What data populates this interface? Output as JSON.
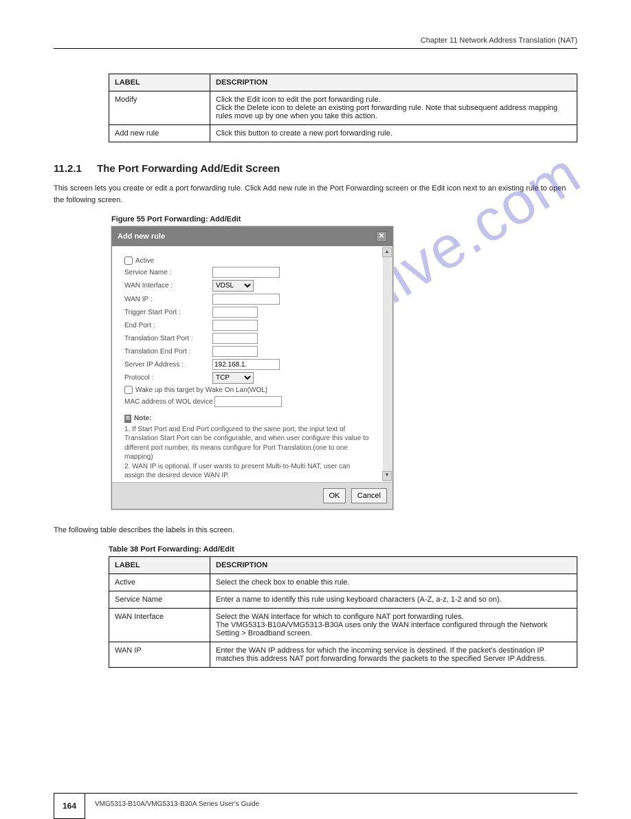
{
  "header": {
    "chapter": "Chapter 11 Network Address Translation (NAT)"
  },
  "watermark": "manualshive.com",
  "table1": {
    "headers": [
      "LABEL",
      "DESCRIPTION"
    ],
    "rows": [
      [
        "Modify",
        "Click the Edit icon to edit the port forwarding rule.\nClick the Delete icon to delete an existing port forwarding rule. Note that subsequent address mapping rules move up by one when you take this action."
      ],
      [
        "Add new rule",
        "Click this button to create a new port forwarding rule."
      ]
    ]
  },
  "section": {
    "number": "11.2.1",
    "title": "The Port Forwarding Add/Edit Screen",
    "intro": "This screen lets you create or edit a port forwarding rule. Click Add new rule in the Port Forwarding screen or the Edit icon next to an existing rule to open the following screen."
  },
  "figure": {
    "caption": "Figure 55   Port Forwarding: Add/Edit"
  },
  "dialog": {
    "title": "Add new rule",
    "active_label": "Active",
    "fields": {
      "service_name": "Service Name :",
      "wan_interface": "WAN Interface :",
      "wan_ip": "WAN IP :",
      "trigger_start": "Trigger Start Port :",
      "end_port": "End Port :",
      "trans_start": "Translation Start Port :",
      "trans_end": "Translation End Port :",
      "server_ip": "Server IP Address :",
      "protocol": "Protocol :",
      "wol": "Wake up this target by Wake On Lan(WOL)",
      "mac": "MAC address of WOL device"
    },
    "values": {
      "wan_interface": "VDSL",
      "server_ip": "192.168.1.",
      "protocol": "TCP"
    },
    "note_title": "Note:",
    "note_body": "1.  If Start Port and End Port configured to the same port, the input text of Translation Start Port can be configurable, and when user configure this value to different port number, its means configure for Port Translation.(one to one mapping)\n2.  WAN IP is optional. If user wants to present Multi-to-Multi NAT, user can assign the desired device WAN IP.",
    "ok": "OK",
    "cancel": "Cancel"
  },
  "table2_caption": "The following table describes the labels in this screen.",
  "table2_title": "Table 38   Port Forwarding: Add/Edit",
  "table2": {
    "headers": [
      "LABEL",
      "DESCRIPTION"
    ],
    "rows": [
      [
        "Active",
        "Select the check box to enable this rule."
      ],
      [
        "Service Name",
        "Enter a name to identify this rule using keyboard characters (A-Z, a-z, 1-2 and so on)."
      ],
      [
        "WAN Interface",
        "Select the WAN interface for which to configure NAT port forwarding rules.\nThe VMG5313-B10A/VMG5313-B30A uses only the WAN interface configured through the Network Setting > Broadband screen."
      ],
      [
        "WAN IP",
        "Enter the WAN IP address for which the incoming service is destined. If the packet's destination IP matches this address NAT port forwarding forwards the packets to the specified Server IP Address."
      ]
    ]
  },
  "footer": {
    "page": "164",
    "text": "VMG5313-B10A/VMG5313-B30A Series User's Guide"
  }
}
